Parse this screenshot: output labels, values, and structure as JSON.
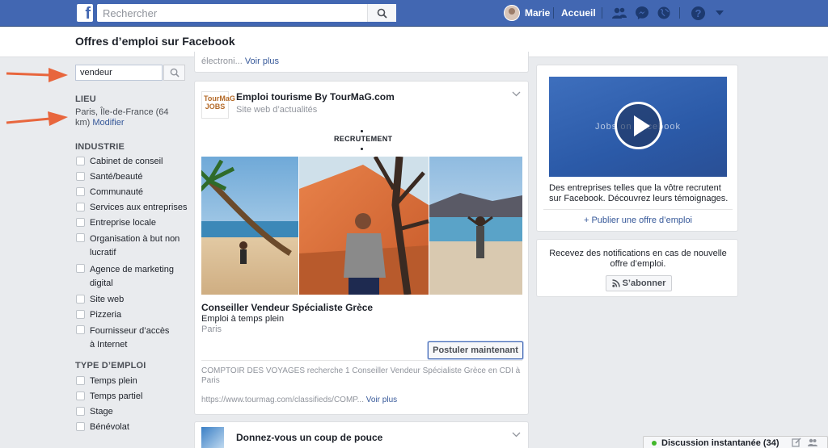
{
  "topbar": {
    "logo": "f",
    "search_placeholder": "Rechercher",
    "user_name": "Marie",
    "home_label": "Accueil",
    "icons": [
      "friends-icon",
      "messenger-icon",
      "notifications-globe-icon",
      "help-icon",
      "dropdown-caret-icon"
    ]
  },
  "page": {
    "title": "Offres d’emploi sur Facebook"
  },
  "sidebar": {
    "keyword_value": "vendeur",
    "location_heading": "LIEU",
    "location_text": "Paris, Île-de-France (64 km)",
    "location_edit": "Modifier",
    "industry_heading": "INDUSTRIE",
    "industries": [
      "Cabinet de conseil",
      "Santé/beauté",
      "Communauté",
      "Services aux entreprises",
      "Entreprise locale",
      "Organisation à but non lucratif",
      "Agence de marketing digital",
      "Site web",
      "Pizzeria",
      "Fournisseur d’accès à Internet"
    ],
    "job_type_heading": "TYPE D’EMPLOI",
    "job_types": [
      "Temps plein",
      "Temps partiel",
      "Stage",
      "Bénévolat"
    ]
  },
  "feed": {
    "prev_snippet": "électroni...",
    "prev_more": "Voir plus",
    "post": {
      "logo_text": "TourMaG JOBS",
      "page_name": "Emploi tourisme By TourMaG.com",
      "page_category": "Site web d’actualités",
      "banner": "RECRUTEMENT",
      "job_title": "Conseiller Vendeur Spécialiste Grèce",
      "job_type": "Emploi à temps plein",
      "job_location": "Paris",
      "apply_label": "Postuler maintenant",
      "description": "COMPTOIR DES VOYAGES recherche 1 Conseiller Vendeur Spécialiste Grèce en CDI à Paris",
      "url": "https://www.tourmag.com/classifieds/COMP...",
      "more": "Voir plus"
    },
    "next_post": {
      "title": "Donnez-vous un coup de pouce"
    }
  },
  "right": {
    "video_caption": "Jobs on Facebook",
    "video_desc": "Des entreprises telles que la vôtre recrutent sur Facebook. Découvrez leurs témoignages.",
    "publish_label": "+ Publier une offre d’emploi",
    "notify_text": "Recevez des notifications en cas de nouvelle offre d’emploi.",
    "subscribe_label": "S’abonner"
  },
  "chat": {
    "label": "Discussion instantanée (34)"
  },
  "colors": {
    "brand_blue": "#4267b2",
    "link": "#365899",
    "background": "#e9ebee",
    "annotation_arrow": "#e8663d",
    "online": "#42b72a"
  }
}
